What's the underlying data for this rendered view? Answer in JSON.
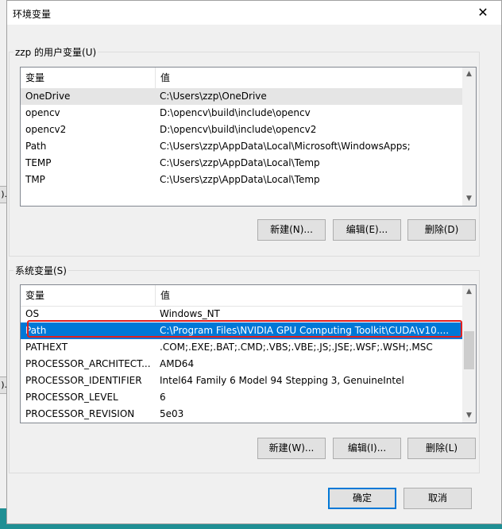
{
  "dialog": {
    "title": "环境变量",
    "close_glyph": "✕"
  },
  "background_window": {
    "fragments": [
      ").",
      ")."
    ]
  },
  "user_vars": {
    "group_label": "zzp 的用户变量(U)",
    "headers": {
      "name": "变量",
      "value": "值"
    },
    "rows": [
      {
        "name": "OneDrive",
        "value": "C:\\Users\\zzp\\OneDrive",
        "state": "hover"
      },
      {
        "name": "opencv",
        "value": "D:\\opencv\\build\\include\\opencv",
        "state": ""
      },
      {
        "name": "opencv2",
        "value": "D:\\opencv\\build\\include\\opencv2",
        "state": ""
      },
      {
        "name": "Path",
        "value": "C:\\Users\\zzp\\AppData\\Local\\Microsoft\\WindowsApps;",
        "state": ""
      },
      {
        "name": "TEMP",
        "value": "C:\\Users\\zzp\\AppData\\Local\\Temp",
        "state": ""
      },
      {
        "name": "TMP",
        "value": "C:\\Users\\zzp\\AppData\\Local\\Temp",
        "state": ""
      }
    ],
    "buttons": {
      "new": "新建(N)...",
      "edit": "编辑(E)...",
      "delete": "删除(D)"
    }
  },
  "sys_vars": {
    "group_label": "系统变量(S)",
    "headers": {
      "name": "变量",
      "value": "值"
    },
    "rows": [
      {
        "name": "OS",
        "value": "Windows_NT",
        "state": ""
      },
      {
        "name": "Path",
        "value": "C:\\Program Files\\NVIDIA GPU Computing Toolkit\\CUDA\\v10....",
        "state": "selected"
      },
      {
        "name": "PATHEXT",
        "value": ".COM;.EXE;.BAT;.CMD;.VBS;.VBE;.JS;.JSE;.WSF;.WSH;.MSC",
        "state": ""
      },
      {
        "name": "PROCESSOR_ARCHITECT...",
        "value": "AMD64",
        "state": ""
      },
      {
        "name": "PROCESSOR_IDENTIFIER",
        "value": "Intel64 Family 6 Model 94 Stepping 3, GenuineIntel",
        "state": ""
      },
      {
        "name": "PROCESSOR_LEVEL",
        "value": "6",
        "state": ""
      },
      {
        "name": "PROCESSOR_REVISION",
        "value": "5e03",
        "state": ""
      }
    ],
    "scroll_position": 0.45,
    "buttons": {
      "new": "新建(W)...",
      "edit": "编辑(I)...",
      "delete": "删除(L)"
    }
  },
  "footer": {
    "ok": "确定",
    "cancel": "取消"
  }
}
